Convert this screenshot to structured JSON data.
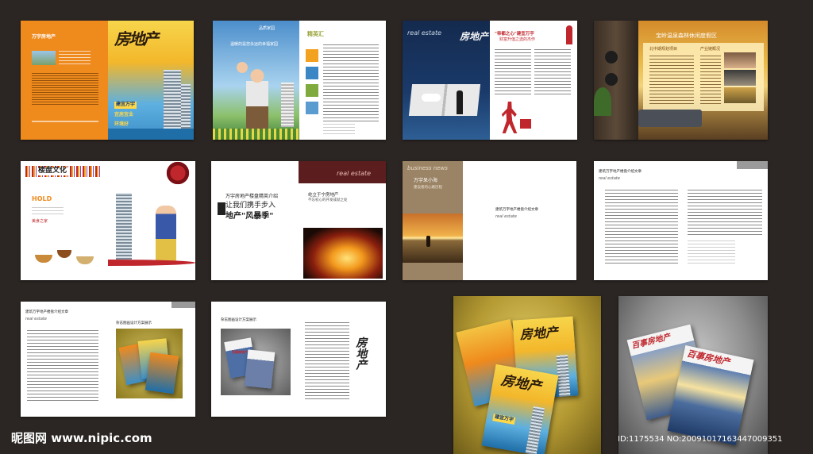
{
  "spreads": {
    "s1": {
      "left_title": "万宇房地产",
      "logo": "房地产",
      "tag1": "建宜万宇",
      "tag2": "宜居宜业",
      "tag3": "环境好"
    },
    "s2": {
      "caption_left": "温暖的是您永远的幸福家园",
      "caption_top": "品质家园",
      "heading_right": "精英汇"
    },
    "s3": {
      "brand": "real estate",
      "logo": "房地产",
      "heading": "\"帝都之心\"建宜万宇",
      "subheading": "财富升值之选的杰作"
    },
    "s4": {
      "title": "宝岭温泉森林休闲度假区",
      "col1": "北中期规划项目",
      "col2": "产业链概况"
    },
    "s5": {
      "title": "楼盘文化",
      "sub": "HOLD",
      "sub2": "美食之家"
    },
    "s6": {
      "brand": "real estate",
      "title_small": "万宇房地产楼盘精英介绍",
      "title_line1": "让我们携手步入",
      "title_line2": "地产\"风暴季\"",
      "right_title": "屹立于宁房地产",
      "right_sub": "不忘初心的开发成就之处"
    },
    "s7": {
      "brand": "business news",
      "title": "万宇呆小海",
      "sub": "建设者的心路历程",
      "right_title": "建筑万宇地产楼盘介绍文章",
      "right_brand": "real estate"
    },
    "s8": {
      "title": "建筑万宇地产楼盘介绍文章",
      "brand": "real estate"
    },
    "s9": {
      "left_title": "建筑万宇地产楼盘介绍文章",
      "left_brand": "real estate",
      "right_title": "杂志图画设计方案展示"
    },
    "s10": {
      "left_title": "杂志图画设计方案展示",
      "logo": "房地产",
      "mag_title": "百事房地产"
    },
    "s11": {
      "logo": "房地产",
      "tag": "建宜万宇"
    },
    "s12": {
      "mag_title": "百事房地产"
    }
  },
  "footer": {
    "site": "昵图网 www.nipic.com",
    "id_text": "ID:1175534 NO:20091017163447009351"
  },
  "colors": {
    "background": "#2b2623",
    "orange": "#ef8a1d",
    "navy": "#142a4e",
    "accent_red": "#c0272d"
  }
}
